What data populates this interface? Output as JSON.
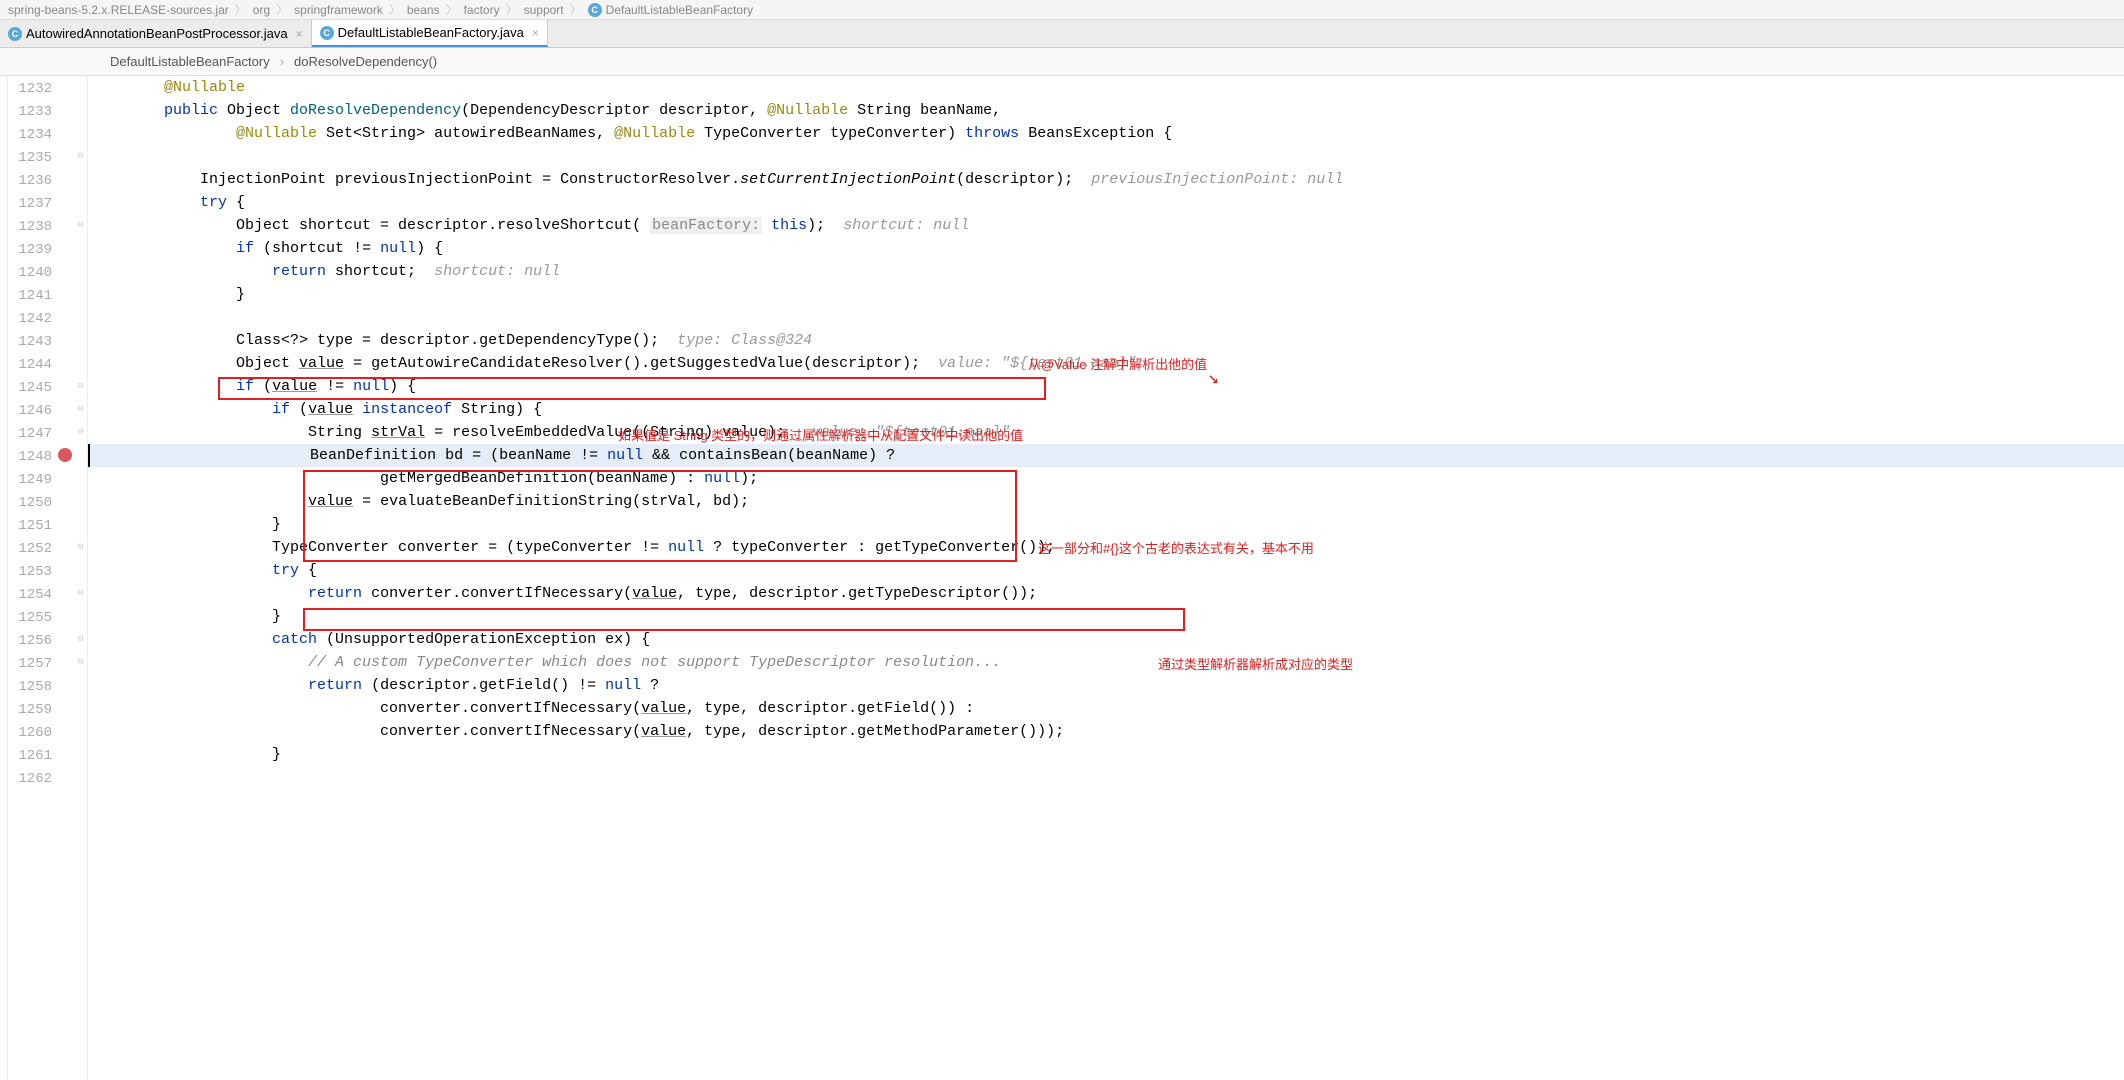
{
  "top_breadcrumb": {
    "path": "spring-beans-5.2.x.RELEASE-sources.jar",
    "parts": [
      "org",
      "springframework",
      "beans",
      "factory",
      "support",
      "DefaultListableBeanFactory"
    ]
  },
  "tabs": [
    {
      "label": "AutowiredAnnotationBeanPostProcessor.java",
      "active": false,
      "icon": "C"
    },
    {
      "label": "DefaultListableBeanFactory.java",
      "active": true,
      "icon": "C"
    }
  ],
  "crumbs": {
    "class": "DefaultListableBeanFactory",
    "method": "doResolveDependency()"
  },
  "line_start": 1232,
  "line_end": 1262,
  "highlighted_line": 1248,
  "breakpoint_line": 1248,
  "fold_lines": [
    1235,
    1238,
    1245,
    1246,
    1247,
    1252,
    1254,
    1256,
    1257
  ],
  "annotations": {
    "a1": "从@Value 注解中解析出他的值",
    "a2": "如果值是 String 类型的，则通过属性解析器中从配置文件中读出他的值",
    "a3": "这一部分和#{}这个古老的表达式有关，基本不用",
    "a4": "通过类型解析器解析成对应的类型"
  },
  "code": {
    "1232": {
      "indent": 2,
      "tokens": [
        {
          "t": "ann",
          "v": "@Nullable"
        }
      ]
    },
    "1233": {
      "indent": 2,
      "tokens": [
        {
          "t": "kw",
          "v": "public"
        },
        {
          "t": "",
          "v": " Object "
        },
        {
          "t": "method",
          "v": "doResolveDependency"
        },
        {
          "t": "",
          "v": "(DependencyDescriptor descriptor, "
        },
        {
          "t": "ann",
          "v": "@Nullable"
        },
        {
          "t": "",
          "v": " String beanName,"
        }
      ]
    },
    "1234": {
      "indent": 4,
      "tokens": [
        {
          "t": "ann",
          "v": "@Nullable"
        },
        {
          "t": "",
          "v": " Set<String> autowiredBeanNames, "
        },
        {
          "t": "ann",
          "v": "@Nullable"
        },
        {
          "t": "",
          "v": " TypeConverter typeConverter) "
        },
        {
          "t": "kw",
          "v": "throws"
        },
        {
          "t": "",
          "v": " BeansException {"
        }
      ]
    },
    "1235": {
      "indent": 2,
      "tokens": []
    },
    "1236": {
      "indent": 3,
      "tokens": [
        {
          "t": "",
          "v": "InjectionPoint previousInjectionPoint = ConstructorResolver."
        },
        {
          "t": "italic",
          "v": "setCurrentInjectionPoint"
        },
        {
          "t": "",
          "v": "(descriptor);  "
        },
        {
          "t": "inlay",
          "v": "previousInjectionPoint: null"
        }
      ]
    },
    "1237": {
      "indent": 3,
      "tokens": [
        {
          "t": "kw",
          "v": "try"
        },
        {
          "t": "",
          "v": " {"
        }
      ]
    },
    "1238": {
      "indent": 4,
      "tokens": [
        {
          "t": "",
          "v": "Object shortcut = descriptor.resolveShortcut( "
        },
        {
          "t": "param-h",
          "v": "beanFactory:"
        },
        {
          "t": "",
          "v": " "
        },
        {
          "t": "kw",
          "v": "this"
        },
        {
          "t": "",
          "v": ");  "
        },
        {
          "t": "inlay",
          "v": "shortcut: null"
        }
      ]
    },
    "1239": {
      "indent": 4,
      "tokens": [
        {
          "t": "kw",
          "v": "if"
        },
        {
          "t": "",
          "v": " (shortcut != "
        },
        {
          "t": "kw",
          "v": "null"
        },
        {
          "t": "",
          "v": ") {"
        }
      ]
    },
    "1240": {
      "indent": 5,
      "tokens": [
        {
          "t": "kw",
          "v": "return"
        },
        {
          "t": "",
          "v": " shortcut;  "
        },
        {
          "t": "inlay",
          "v": "shortcut: null"
        }
      ]
    },
    "1241": {
      "indent": 4,
      "tokens": [
        {
          "t": "",
          "v": "}"
        }
      ]
    },
    "1242": {
      "indent": 2,
      "tokens": []
    },
    "1243": {
      "indent": 4,
      "tokens": [
        {
          "t": "",
          "v": "Class<?> type = descriptor.getDependencyType();  "
        },
        {
          "t": "inlay",
          "v": "type: Class@324"
        }
      ]
    },
    "1244": {
      "indent": 4,
      "tokens": [
        {
          "t": "",
          "v": "Object "
        },
        {
          "t": "ul",
          "v": "value"
        },
        {
          "t": "",
          "v": " = getAutowireCandidateResolver().getSuggestedValue(descriptor);"
        },
        {
          "t": "",
          "v": "  "
        },
        {
          "t": "inlay",
          "v": "value: \"${test01.aaa}\""
        }
      ]
    },
    "1245": {
      "indent": 4,
      "tokens": [
        {
          "t": "kw",
          "v": "if"
        },
        {
          "t": "",
          "v": " ("
        },
        {
          "t": "ul",
          "v": "value"
        },
        {
          "t": "",
          "v": " != "
        },
        {
          "t": "kw",
          "v": "null"
        },
        {
          "t": "",
          "v": ") {"
        }
      ]
    },
    "1246": {
      "indent": 5,
      "tokens": [
        {
          "t": "kw",
          "v": "if"
        },
        {
          "t": "",
          "v": " ("
        },
        {
          "t": "ul",
          "v": "value"
        },
        {
          "t": "",
          "v": " "
        },
        {
          "t": "kw",
          "v": "instanceof"
        },
        {
          "t": "",
          "v": " String) {"
        }
      ]
    },
    "1247": {
      "indent": 6,
      "tokens": [
        {
          "t": "",
          "v": "String "
        },
        {
          "t": "ul",
          "v": "strVal"
        },
        {
          "t": "",
          "v": " = resolveEmbeddedValue((String) value);   "
        },
        {
          "t": "inlay",
          "v": "value: \"${test01.aaa}\""
        }
      ]
    },
    "1248": {
      "indent": 6,
      "tokens": [
        {
          "t": "",
          "v": "BeanDefinition bd = (beanName != "
        },
        {
          "t": "kw",
          "v": "null"
        },
        {
          "t": "",
          "v": " && containsBean(beanName) ?"
        }
      ]
    },
    "1249": {
      "indent": 8,
      "tokens": [
        {
          "t": "",
          "v": "getMergedBeanDefinition(beanName) : "
        },
        {
          "t": "kw",
          "v": "null"
        },
        {
          "t": "",
          "v": ");"
        }
      ]
    },
    "1250": {
      "indent": 6,
      "tokens": [
        {
          "t": "ul",
          "v": "value"
        },
        {
          "t": "",
          "v": " = evaluateBeanDefinitionString(strVal, bd);"
        }
      ]
    },
    "1251": {
      "indent": 5,
      "tokens": [
        {
          "t": "",
          "v": "}"
        }
      ]
    },
    "1252": {
      "indent": 5,
      "tokens": [
        {
          "t": "",
          "v": "TypeConverter converter = (typeConverter != "
        },
        {
          "t": "kw",
          "v": "null"
        },
        {
          "t": "",
          "v": " ? typeConverter : getTypeConverter());"
        }
      ]
    },
    "1253": {
      "indent": 5,
      "tokens": [
        {
          "t": "kw",
          "v": "try"
        },
        {
          "t": "",
          "v": " {"
        }
      ]
    },
    "1254": {
      "indent": 6,
      "tokens": [
        {
          "t": "kw",
          "v": "return"
        },
        {
          "t": "",
          "v": " converter.convertIfNecessary("
        },
        {
          "t": "ul",
          "v": "value"
        },
        {
          "t": "",
          "v": ", type, descriptor.getTypeDescriptor());"
        }
      ]
    },
    "1255": {
      "indent": 5,
      "tokens": [
        {
          "t": "",
          "v": "}"
        }
      ]
    },
    "1256": {
      "indent": 5,
      "tokens": [
        {
          "t": "kw",
          "v": "catch"
        },
        {
          "t": "",
          "v": " (UnsupportedOperationException ex) {"
        }
      ]
    },
    "1257": {
      "indent": 6,
      "tokens": [
        {
          "t": "comment",
          "v": "// A custom TypeConverter which does not support TypeDescriptor resolution..."
        }
      ]
    },
    "1258": {
      "indent": 6,
      "tokens": [
        {
          "t": "kw",
          "v": "return"
        },
        {
          "t": "",
          "v": " (descriptor.getField() != "
        },
        {
          "t": "kw",
          "v": "null"
        },
        {
          "t": "",
          "v": " ?"
        }
      ]
    },
    "1259": {
      "indent": 8,
      "tokens": [
        {
          "t": "",
          "v": "converter.convertIfNecessary("
        },
        {
          "t": "ul",
          "v": "value"
        },
        {
          "t": "",
          "v": ", type, descriptor.getField()) :"
        }
      ]
    },
    "1260": {
      "indent": 8,
      "tokens": [
        {
          "t": "",
          "v": "converter.convertIfNecessary("
        },
        {
          "t": "ul",
          "v": "value"
        },
        {
          "t": "",
          "v": ", type, descriptor.getMethodParameter()));"
        }
      ]
    },
    "1261": {
      "indent": 5,
      "tokens": [
        {
          "t": "",
          "v": "}"
        }
      ]
    }
  }
}
